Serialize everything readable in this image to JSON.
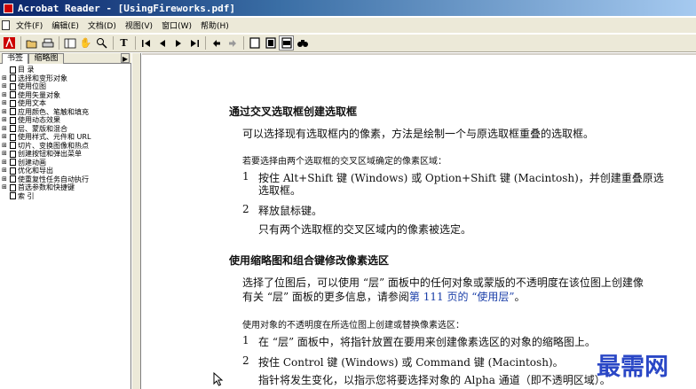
{
  "window": {
    "title": "Acrobat Reader - [UsingFireworks.pdf]"
  },
  "menubar": [
    "文件(F)",
    "编辑(E)",
    "文档(D)",
    "视图(V)",
    "窗口(W)",
    "帮助(H)"
  ],
  "toolbar": {
    "buttons": [
      "acrobat-logo-icon",
      "open-icon",
      "print-icon",
      "show-navigation-icon",
      "hand-tool-icon",
      "zoom-tool-icon",
      "text-select-icon",
      "first-page-icon",
      "previous-page-icon",
      "next-page-icon",
      "last-page-icon",
      "go-back-icon",
      "go-forward-icon",
      "actual-size-icon",
      "fit-page-icon",
      "fit-width-icon",
      "find-icon"
    ],
    "pressed_button": "fit-width-icon"
  },
  "sidebar": {
    "tabs": [
      "书签",
      "缩略图"
    ],
    "active_tab": "书签",
    "bookmarks": [
      {
        "label": "目 录",
        "expandable": false
      },
      {
        "label": "选择和变形对象",
        "expandable": true
      },
      {
        "label": "使用位图",
        "expandable": true
      },
      {
        "label": "使用矢量对象",
        "expandable": true
      },
      {
        "label": "使用文本",
        "expandable": true
      },
      {
        "label": "应用颜色、笔触和填充",
        "expandable": true
      },
      {
        "label": "使用动态效果",
        "expandable": true
      },
      {
        "label": "层、蒙版和混合",
        "expandable": true
      },
      {
        "label": "使用样式、元件和 URL",
        "expandable": true
      },
      {
        "label": "切片、变换图像和热点",
        "expandable": true
      },
      {
        "label": "创建按钮和弹出菜单",
        "expandable": true
      },
      {
        "label": "创建动画",
        "expandable": true
      },
      {
        "label": "优化和导出",
        "expandable": true
      },
      {
        "label": "使重复性任务自动执行",
        "expandable": true
      },
      {
        "label": "首选参数和快捷键",
        "expandable": true
      },
      {
        "label": "索 引",
        "expandable": false
      }
    ]
  },
  "document": {
    "section1": {
      "heading": "通过交叉选取框创建选取框",
      "intro": "可以选择现有选取框内的像素，方法是绘制一个与原选取框重叠的选取框。",
      "steps_title": "若要选择由两个选取框的交叉区域确定的像素区域：",
      "step1_num": "1",
      "step1_line1": "按住 Alt+Shift 键 (Windows) 或 Option+Shift 键 (Macintosh)，并创建重叠原选",
      "step1_line2": "选取框。",
      "step2_num": "2",
      "step2": "释放鼠标键。",
      "result": "只有两个选取框的交叉区域内的像素被选定。"
    },
    "section2": {
      "heading": "使用缩略图和组合键修改像素选区",
      "intro_line1": "选择了位图后，可以使用 “层” 面板中的任何对象或蒙版的不透明度在该位图上创建像",
      "intro_line2_pre": "有关 “层” 面板的更多信息，请参阅",
      "intro_line2_link": "第 111 页的 “使用层”",
      "intro_line2_post": "。",
      "steps_title": "使用对象的不透明度在所选位图上创建或替换像素选区：",
      "step1_num": "1",
      "step1": "在 “层” 面板中，将指针放置在要用来创建像素选区的对象的缩略图上。",
      "step2_num": "2",
      "step2": "按住 Control 键 (Windows) 或 Command 键 (Macintosh)。",
      "step2_note": "指针将发生变化，以指示您将要选择对象的 Alpha 通道（即不透明区域）。"
    }
  },
  "watermark": "最需网",
  "colors": {
    "titlebar": "#0a246a",
    "chrome": "#ece9d8",
    "link": "#1a3ea8",
    "watermark": "#2a47c6"
  }
}
